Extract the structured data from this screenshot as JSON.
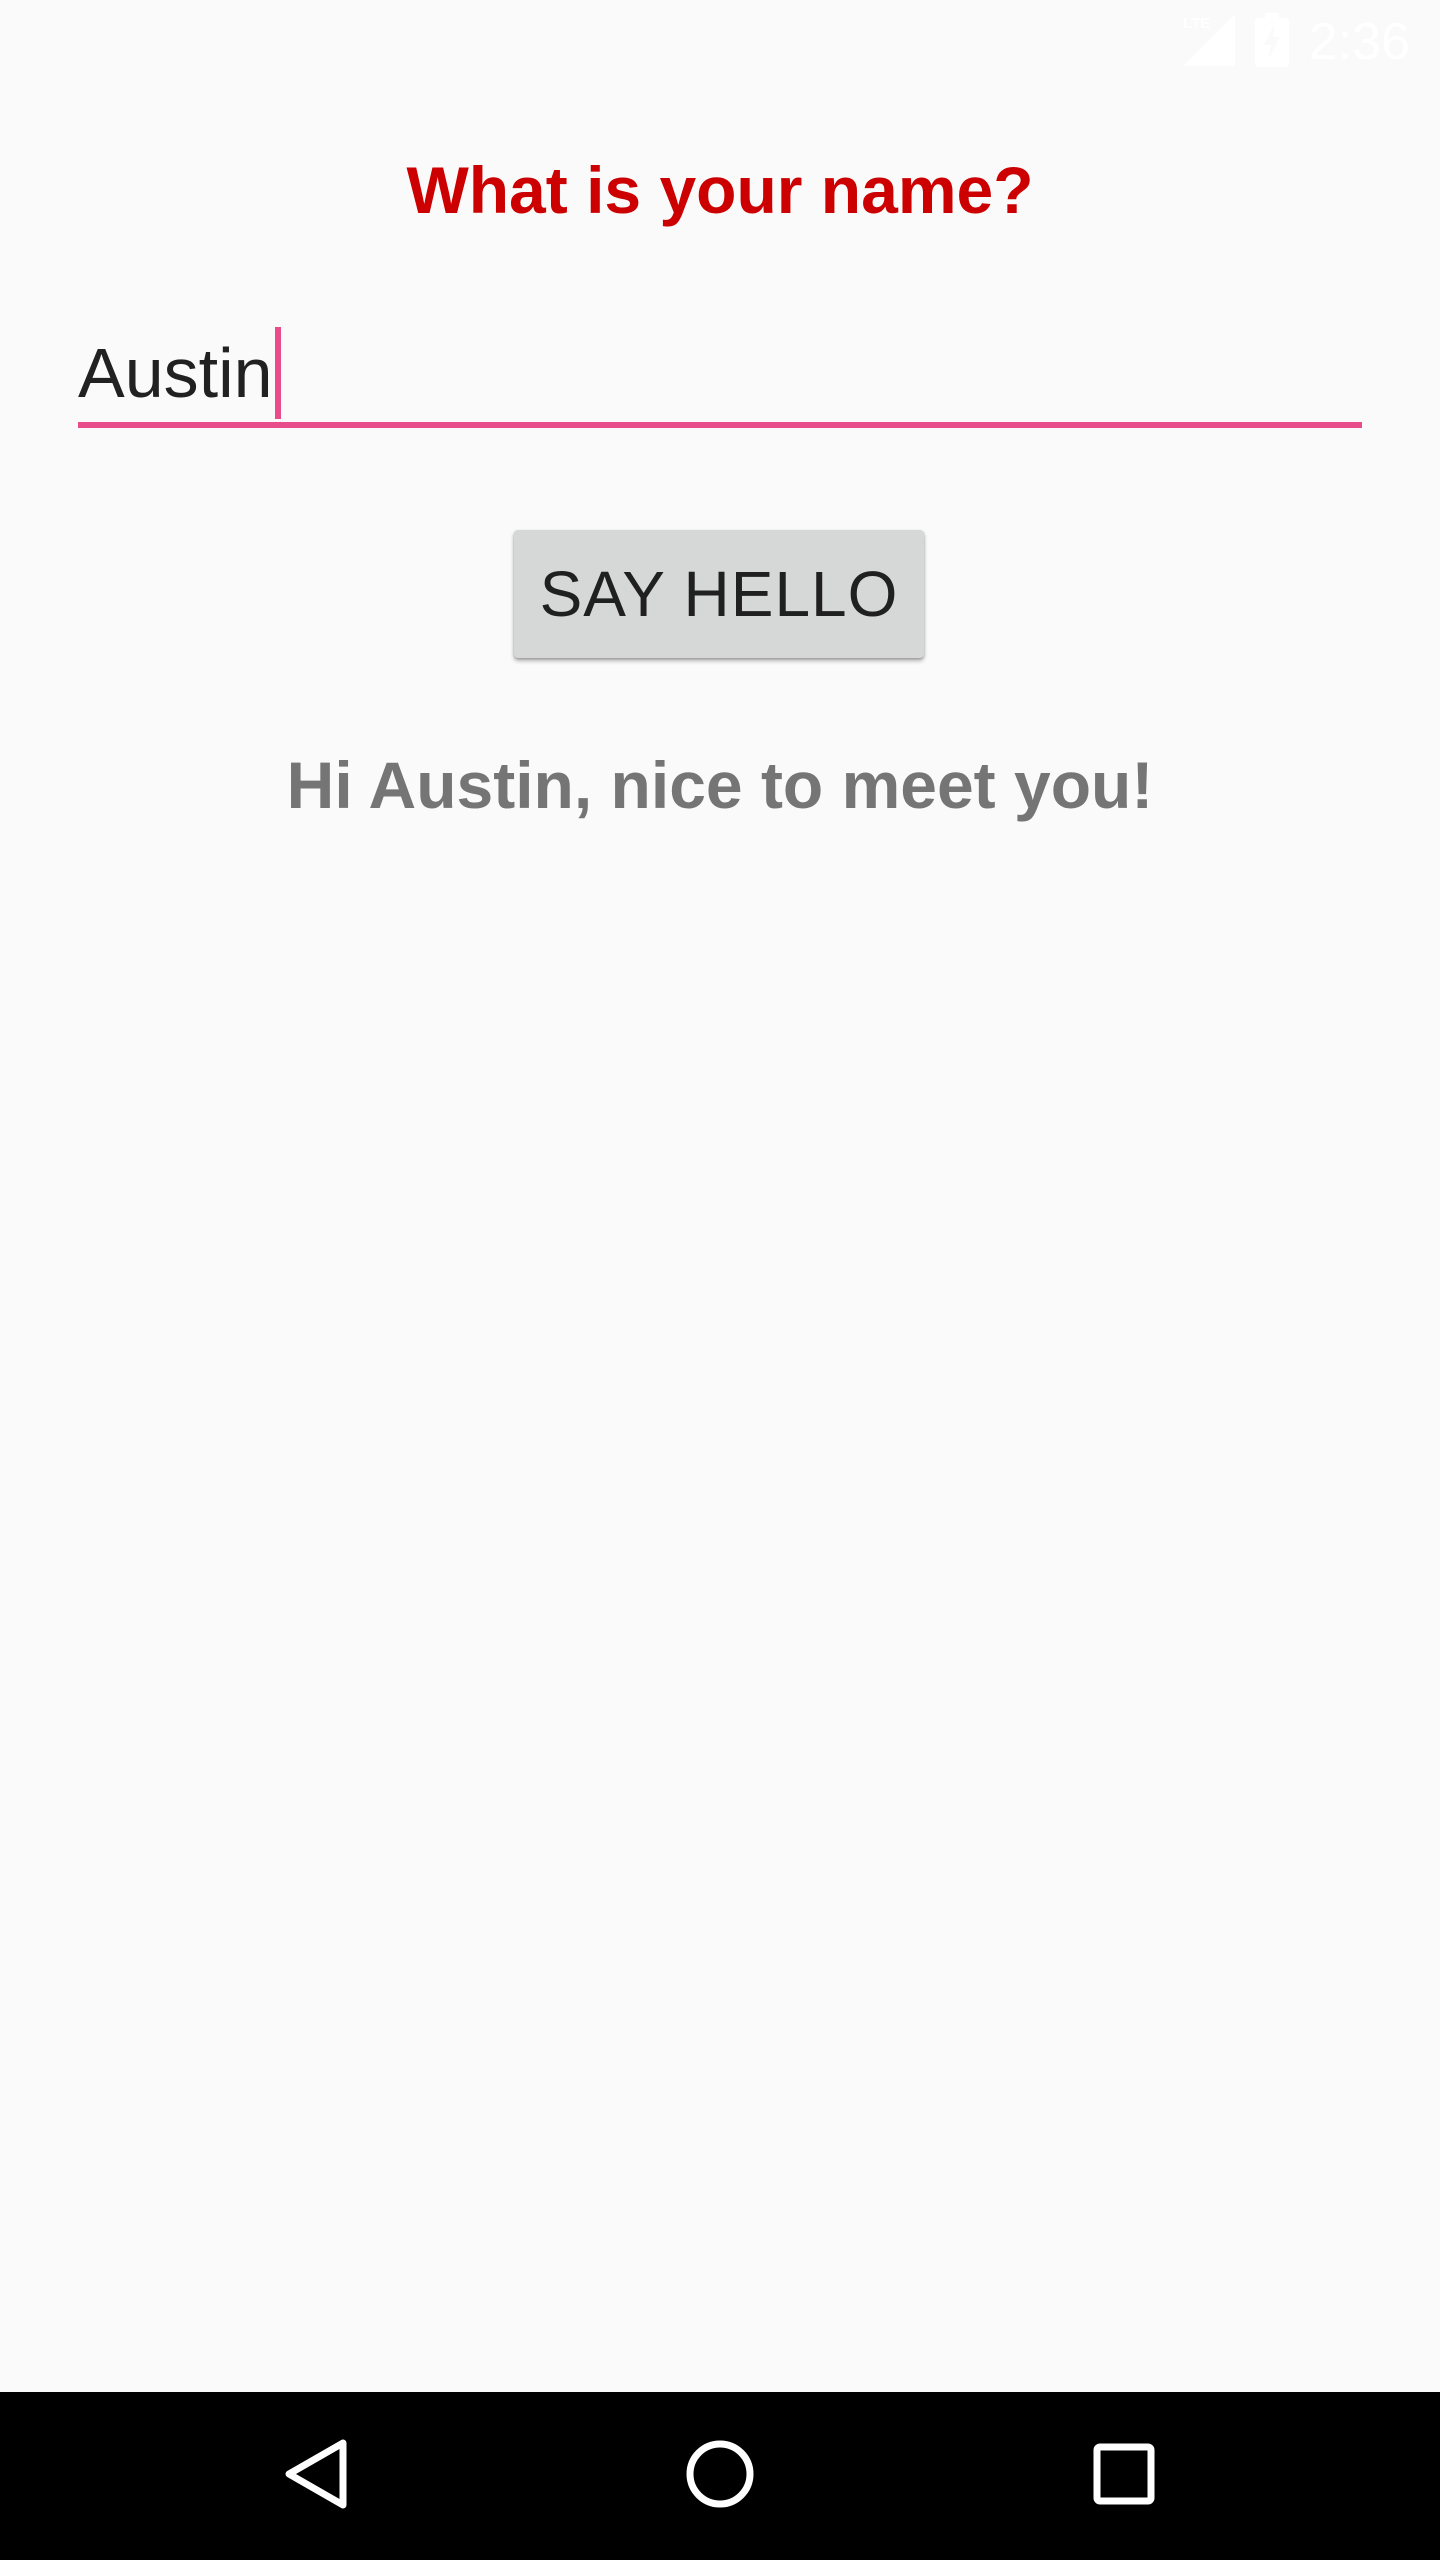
{
  "status_bar": {
    "network_label": "LTE",
    "time": "2:36",
    "icons": [
      "lte-signal-icon",
      "battery-charging-icon"
    ]
  },
  "main": {
    "question": "What is your name?",
    "name_input": {
      "value": "Austin"
    },
    "button_label": "SAY HELLO",
    "greeting": "Hi Austin, nice to meet you!"
  },
  "nav_bar": {
    "buttons": [
      "back-icon",
      "home-icon",
      "recents-icon"
    ]
  },
  "colors": {
    "question": "#cc0000",
    "input_underline": "#e94c8a",
    "greeting": "#757575",
    "button_bg": "#d6d7d7",
    "background": "#fafafa"
  }
}
